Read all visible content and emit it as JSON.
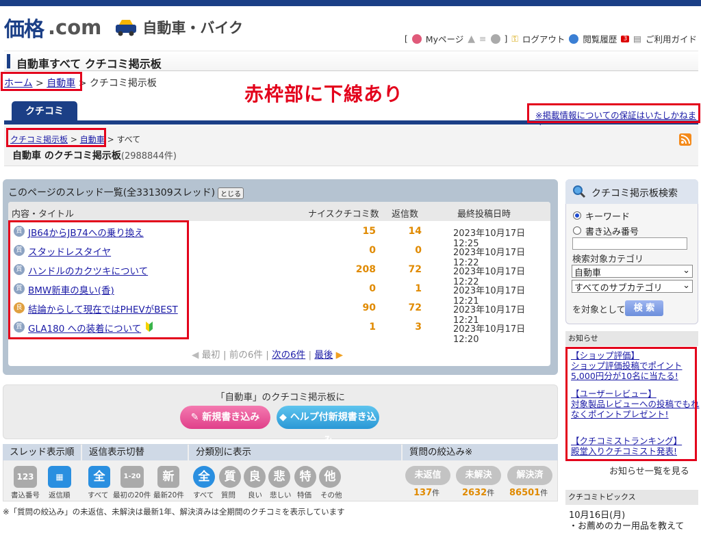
{
  "site": {
    "name_kanji": "価格",
    "name_com": ".com",
    "category": "自動車・バイク"
  },
  "usernav": {
    "bracket_open": "[",
    "mypage": "Myページ",
    "bracket_close": "]",
    "logout": "ログアウト",
    "history": "閲覧履歴",
    "history_badge": "3",
    "guide": "ご利用ガイド"
  },
  "page": {
    "title": "自動車すべて クチコミ掲示板"
  },
  "breadcrumb": {
    "home": "ホーム",
    "sep1": ">",
    "car": "自動車",
    "sep2": ">",
    "current": "クチコミ掲示板"
  },
  "annotation": "赤枠部に下線あり",
  "tab": {
    "label": "クチコミ"
  },
  "disclaimer": "※掲載情報についての保証はいたしかねます",
  "sub_breadcrumb": {
    "board": "クチコミ掲示板",
    "sep1": ">",
    "car": "自動車",
    "sep2": ">",
    "current": "すべて"
  },
  "board": {
    "title": "自動車 のクチコミ掲示板",
    "count": "(2988844件)"
  },
  "thread_list": {
    "heading": "このページのスレッド一覧(全331309スレッド)",
    "close_label": "とじる",
    "columns": {
      "title": "内容・タイトル",
      "nice": "ナイスクチコミ数",
      "replies": "返信数",
      "last": "最終投稿日時"
    },
    "rows": [
      {
        "icon": "質",
        "title": "JB64からJB74への乗り換え",
        "nice": "15",
        "replies": "14",
        "date": "2023年10月17日 12:25"
      },
      {
        "icon": "質",
        "title": "スタッドレスタイヤ",
        "nice": "0",
        "replies": "0",
        "date": "2023年10月17日 12:22"
      },
      {
        "icon": "質",
        "title": "ハンドルのカクツキについて",
        "nice": "208",
        "replies": "72",
        "date": "2023年10月17日 12:22"
      },
      {
        "icon": "質",
        "title": "BMW新車の臭い(香)",
        "nice": "0",
        "replies": "1",
        "date": "2023年10月17日 12:21"
      },
      {
        "icon": "良",
        "title": "結論からして現在ではPHEVがBEST",
        "nice": "90",
        "replies": "72",
        "date": "2023年10月17日 12:21"
      },
      {
        "icon": "質",
        "title": "GLA180 への装着について",
        "nice": "1",
        "replies": "3",
        "date": "2023年10月17日 12:20"
      }
    ],
    "pager": {
      "first": "最初",
      "prev": "前の6件",
      "next": "次の6件",
      "last": "最後",
      "sep": "|"
    }
  },
  "newpost": {
    "text": "「自動車」のクチコミ掲示板に",
    "new_button": "新規書き込み",
    "help_button": "ヘルプ付新規書き込み"
  },
  "filters": {
    "sort_head": "スレッド表示順",
    "sort_items": [
      {
        "glyph": "123",
        "label": "書込番号"
      },
      {
        "glyph": "▦",
        "label": "返信順"
      }
    ],
    "reply_head": "返信表示切替",
    "reply_items": [
      {
        "glyph": "全",
        "label": "すべて"
      },
      {
        "glyph": "1-20",
        "label": "最初の20件"
      },
      {
        "glyph": "新",
        "label": "最新20件"
      }
    ],
    "class_head": "分類別に表示",
    "class_items": [
      {
        "glyph": "全",
        "label": "すべて"
      },
      {
        "glyph": "質",
        "label": "質問"
      },
      {
        "glyph": "良",
        "label": "良い"
      },
      {
        "glyph": "悲",
        "label": "悲しい"
      },
      {
        "glyph": "特",
        "label": "特価"
      },
      {
        "glyph": "他",
        "label": "その他"
      }
    ],
    "q_head": "質問の絞込み※",
    "q_items": [
      {
        "label": "未返信",
        "count": "137",
        "unit": "件"
      },
      {
        "label": "未解決",
        "count": "2632",
        "unit": "件"
      },
      {
        "label": "解決済",
        "count": "86501",
        "unit": "件"
      }
    ]
  },
  "footnote": "※「質問の絞込み」の未返信、未解決は最新1年、解決済みは全期間のクチコミを表示しています",
  "search": {
    "title": "クチコミ掲示板検索",
    "opt_keyword": "キーワード",
    "opt_number": "書き込み番号",
    "category_label": "検索対象カテゴリ",
    "category_value": "自動車",
    "sub_value": "すべてのサブカテゴリ",
    "target_label": "を対象として",
    "button": "検 索"
  },
  "notices": {
    "head": "お知らせ",
    "items": [
      {
        "line1": "【ショップ評価】",
        "line2": "ショップ評価投稿でポイント5,000円分が10名に当たる!"
      },
      {
        "line1": "【ユーザーレビュー】",
        "line2": "対象製品レビューへの投稿でもれなくポイントプレゼント!"
      },
      {
        "line1": "【クチコミストランキング】",
        "line2": "殿堂入りクチコミスト発表!"
      }
    ],
    "all": "お知らせ一覧を見る"
  },
  "topics": {
    "head": "クチコミトピックス",
    "date": "10月16日(月)",
    "item": "・お薦めのカー用品を教えて"
  }
}
